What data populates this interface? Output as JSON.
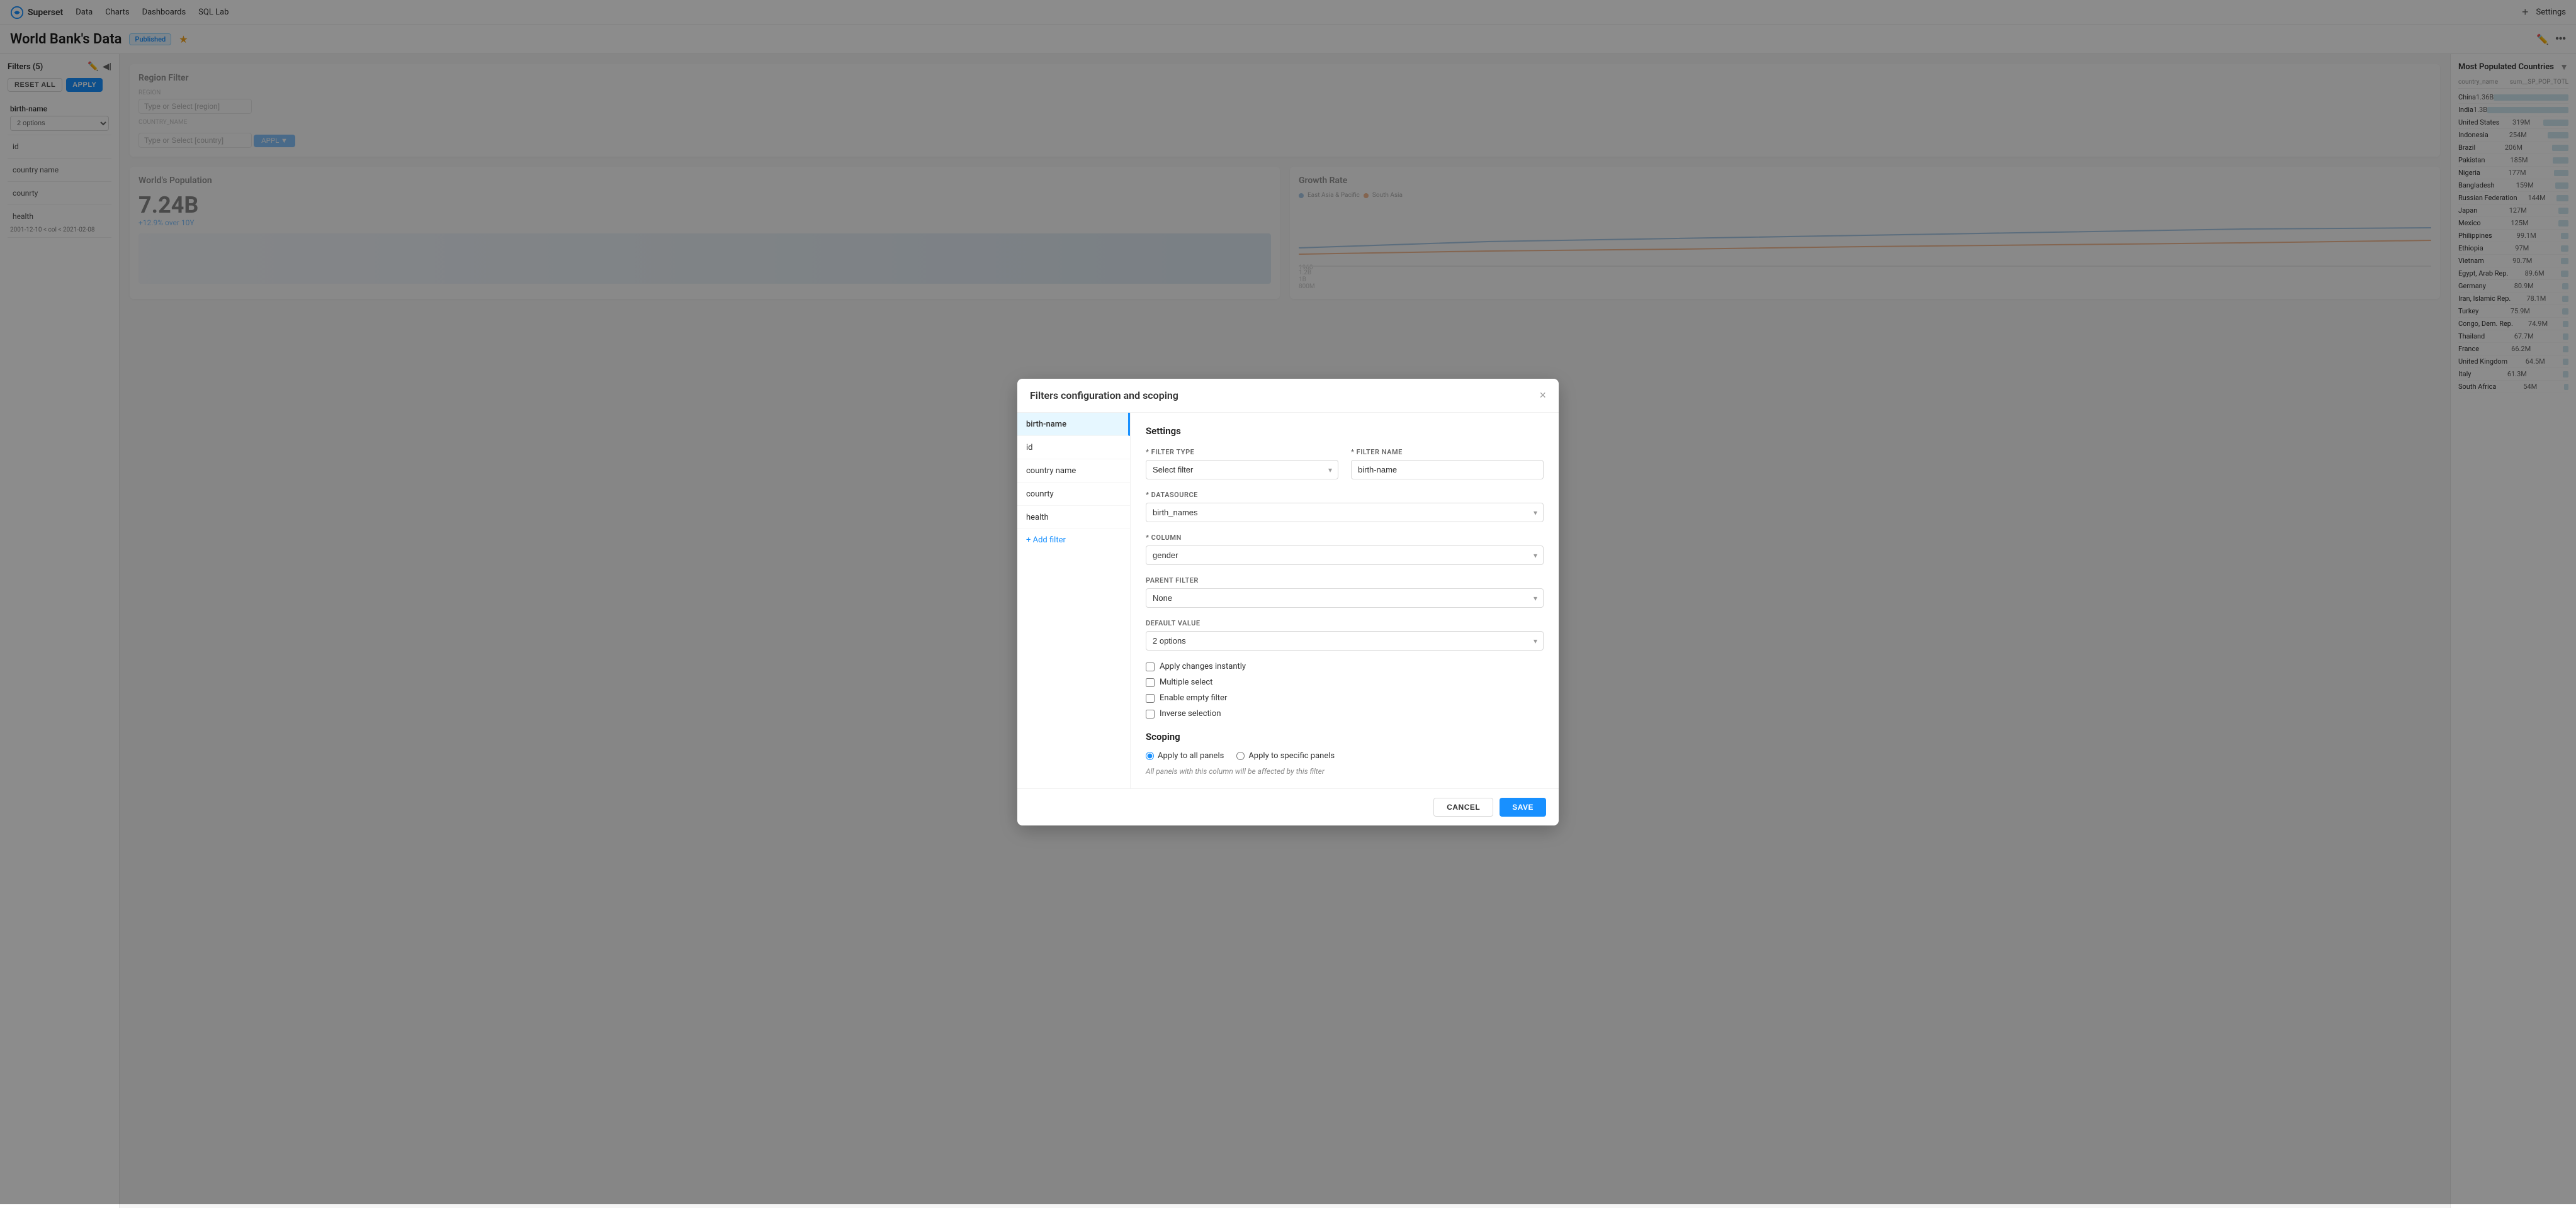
{
  "app": {
    "logo": "superset-logo",
    "name": "Superset"
  },
  "nav": {
    "data_label": "Data",
    "charts_label": "Charts",
    "dashboards_label": "Dashboards",
    "sql_lab_label": "SQL Lab",
    "plus_icon": "+",
    "settings_label": "Settings"
  },
  "page": {
    "title": "World Bank's Data",
    "published_badge": "Published",
    "star": "★"
  },
  "sidebar": {
    "title": "Filters (5)",
    "reset_all": "RESET ALL",
    "apply": "APPLY",
    "filters": [
      {
        "name": "birth-name",
        "has_select": true,
        "select_value": "2 options"
      },
      {
        "name": "id",
        "has_select": false
      },
      {
        "name": "country name",
        "has_select": false
      },
      {
        "name": "counrty",
        "has_select": false
      },
      {
        "name": "health",
        "has_select": false,
        "meta": "2001-12-10 < col < 2021-02-08"
      }
    ]
  },
  "dashboard": {
    "region_filter": {
      "title": "Region Filter",
      "region_label": "REGION",
      "region_placeholder": "Type or Select [region]",
      "country_label": "COUNTRY_NAME",
      "country_placeholder": "Type or Select [country]",
      "apply_btn": "APPL ▼"
    },
    "world_population": {
      "title": "World's Population",
      "value": "7.24B",
      "growth": "+12.9% over 10Y"
    },
    "growth_rate": {
      "title": "Growth Rate"
    }
  },
  "right_panel": {
    "title": "Most Populated Countries",
    "col1": "country_name",
    "col2": "sum__SP_POP_TOTL",
    "rows": [
      {
        "country": "China",
        "value": "1.36B",
        "bar_pct": 100
      },
      {
        "country": "India",
        "value": "1.3B",
        "bar_pct": 96
      },
      {
        "country": "United States",
        "value": "319M",
        "bar_pct": 23
      },
      {
        "country": "Indonesia",
        "value": "254M",
        "bar_pct": 19
      },
      {
        "country": "Brazil",
        "value": "206M",
        "bar_pct": 15
      },
      {
        "country": "Pakistan",
        "value": "185M",
        "bar_pct": 14
      },
      {
        "country": "Nigeria",
        "value": "177M",
        "bar_pct": 13
      },
      {
        "country": "Bangladesh",
        "value": "159M",
        "bar_pct": 12
      },
      {
        "country": "Russian Federation",
        "value": "144M",
        "bar_pct": 11
      },
      {
        "country": "Japan",
        "value": "127M",
        "bar_pct": 9
      },
      {
        "country": "Mexico",
        "value": "125M",
        "bar_pct": 9
      },
      {
        "country": "Philippines",
        "value": "99.1M",
        "bar_pct": 7
      },
      {
        "country": "Ethiopia",
        "value": "97M",
        "bar_pct": 7
      },
      {
        "country": "Vietnam",
        "value": "90.7M",
        "bar_pct": 7
      },
      {
        "country": "Egypt, Arab Rep.",
        "value": "89.6M",
        "bar_pct": 7
      },
      {
        "country": "Germany",
        "value": "80.9M",
        "bar_pct": 6
      },
      {
        "country": "Iran, Islamic Rep.",
        "value": "78.1M",
        "bar_pct": 6
      },
      {
        "country": "Turkey",
        "value": "75.9M",
        "bar_pct": 6
      },
      {
        "country": "Congo, Dem. Rep.",
        "value": "74.9M",
        "bar_pct": 5
      },
      {
        "country": "Thailand",
        "value": "67.7M",
        "bar_pct": 5
      },
      {
        "country": "France",
        "value": "66.2M",
        "bar_pct": 5
      },
      {
        "country": "United Kingdom",
        "value": "64.5M",
        "bar_pct": 5
      },
      {
        "country": "Italy",
        "value": "61.3M",
        "bar_pct": 5
      },
      {
        "country": "South Africa",
        "value": "54M",
        "bar_pct": 4
      }
    ]
  },
  "modal": {
    "title": "Filters configuration and scoping",
    "close_icon": "×",
    "filter_list": [
      {
        "id": "birth-name",
        "active": true
      },
      {
        "id": "id",
        "active": false
      },
      {
        "id": "country name",
        "active": false
      },
      {
        "id": "counrty",
        "active": false
      },
      {
        "id": "health",
        "active": false
      }
    ],
    "add_filter_label": "+ Add filter",
    "settings": {
      "section_title": "Settings",
      "filter_type_label": "* FILTER TYPE",
      "filter_type_value": "Select filter",
      "filter_name_label": "* FILTER NAME",
      "filter_name_value": "birth-name",
      "datasource_label": "* DATASOURCE",
      "datasource_value": "birth_names",
      "column_label": "* COLUMN",
      "column_value": "gender",
      "parent_filter_label": "PARENT FILTER",
      "parent_filter_value": "None",
      "default_value_label": "DEFAULT VALUE",
      "default_value_placeholder": "2 options",
      "checkboxes": [
        {
          "label": "Apply changes instantly",
          "checked": false
        },
        {
          "label": "Multiple select",
          "checked": false
        },
        {
          "label": "Enable empty filter",
          "checked": false
        },
        {
          "label": "Inverse selection",
          "checked": false
        }
      ],
      "scoping_title": "Scoping",
      "radio_options": [
        {
          "label": "Apply to all panels",
          "selected": true
        },
        {
          "label": "Apply to specific panels",
          "selected": false
        }
      ],
      "scoping_note": "All panels with this column will be affected by this filter"
    }
  },
  "footer": {
    "cancel_label": "CANCEL",
    "save_label": "SAVE"
  }
}
